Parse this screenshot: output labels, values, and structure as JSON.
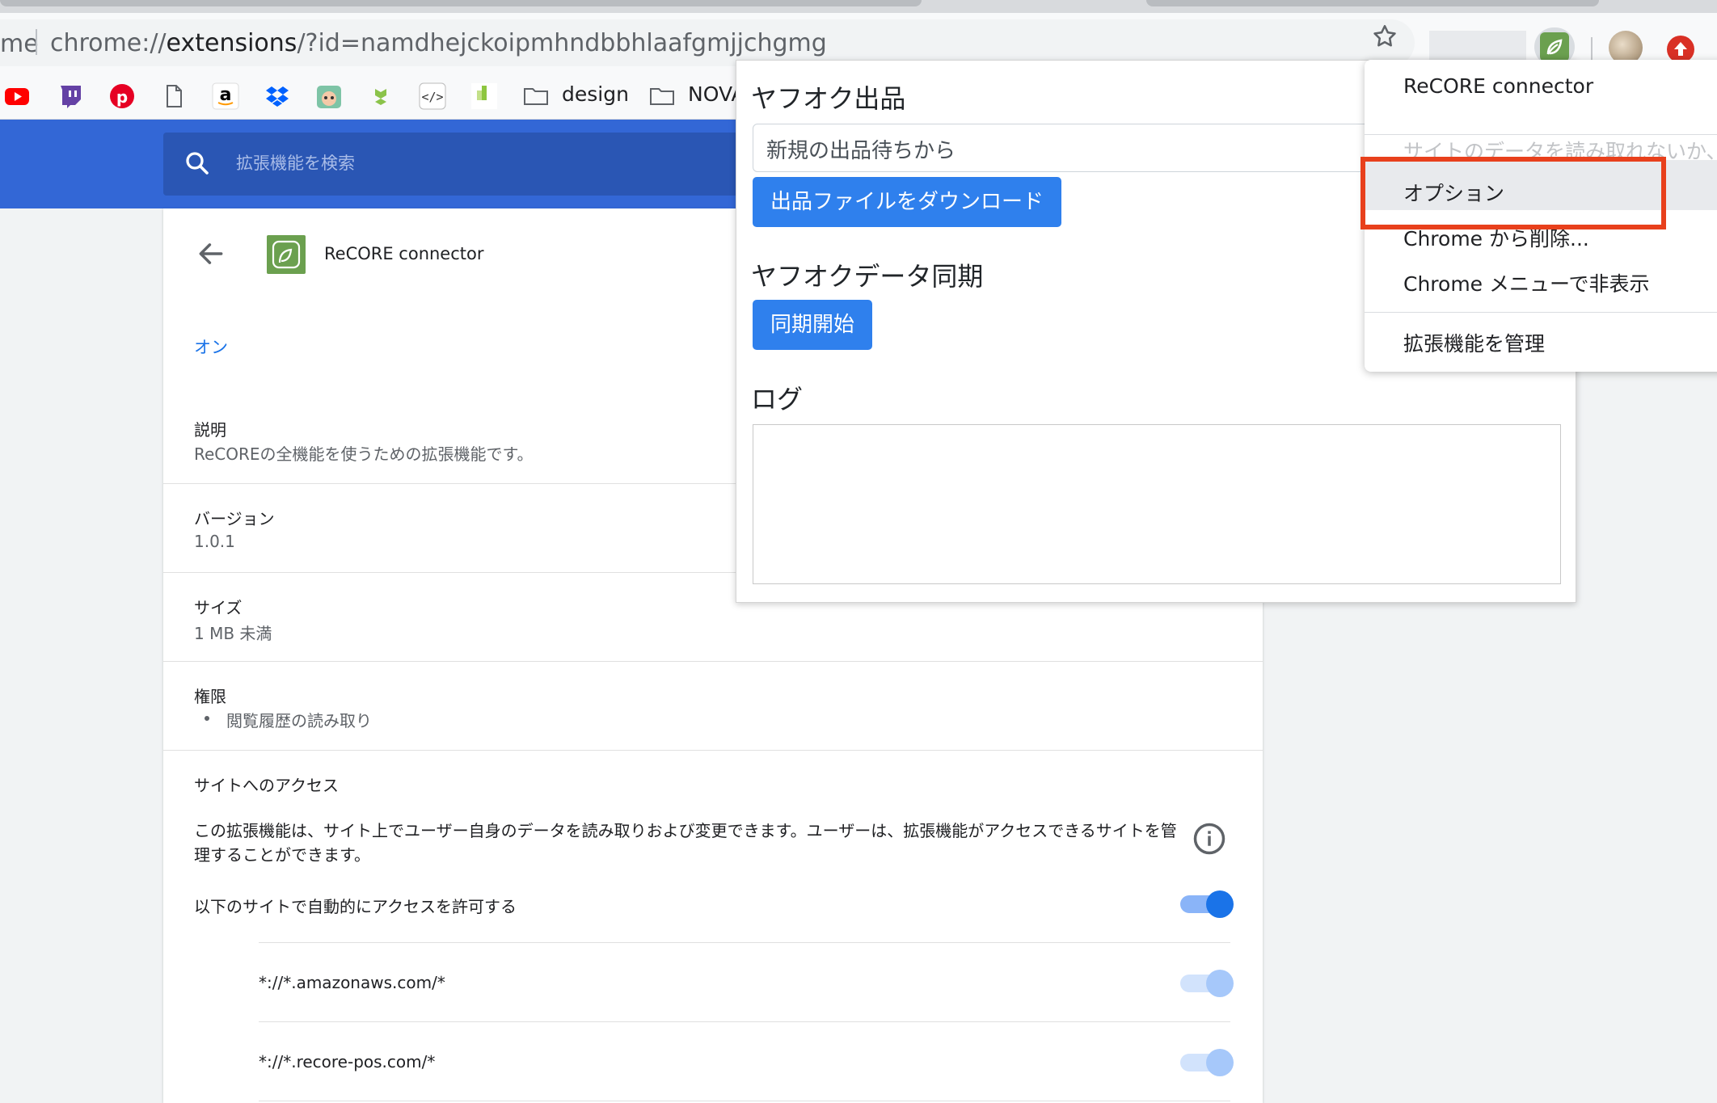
{
  "browser": {
    "url_prefix": "me",
    "url_scheme": "chrome://",
    "url_host": "extensions",
    "url_path": "/?id=namdhejckoipmhndbbhlaafgmjjchgmg",
    "bookmarks": [
      {
        "icon": "youtube-icon",
        "label": ""
      },
      {
        "icon": "twitch-icon",
        "label": ""
      },
      {
        "icon": "pinterest-icon",
        "label": ""
      },
      {
        "icon": "page-icon",
        "label": ""
      },
      {
        "icon": "amazon-icon",
        "label": ""
      },
      {
        "icon": "dropbox-icon",
        "label": ""
      },
      {
        "icon": "cat-icon",
        "label": ""
      },
      {
        "icon": "cubes-icon",
        "label": ""
      },
      {
        "icon": "code-icon",
        "label": ""
      },
      {
        "icon": "smbc-icon",
        "label": ""
      },
      {
        "icon": "folder-icon",
        "label": "design"
      },
      {
        "icon": "folder-icon",
        "label": "NOVA"
      }
    ]
  },
  "extensions_page": {
    "search_placeholder": "拡張機能を検索",
    "extension_name": "ReCORE connector",
    "status": "オン",
    "description_title": "説明",
    "description": "ReCOREの全機能を使うための拡張機能です。",
    "version_title": "バージョン",
    "version": "1.0.1",
    "size_title": "サイズ",
    "size": "1 MB 未満",
    "permissions_title": "権限",
    "permission_item": "閲覧履歴の読み取り",
    "site_access_title": "サイトへのアクセス",
    "site_access_desc_line1": "この拡張機能は、サイト上でユーザー自身のデータを読み取りおよび変更できます。ユーザーは、拡張機能がアクセスできるサイトを管",
    "site_access_desc_line2": "理することができます。",
    "auto_allow_label": "以下のサイトで自動的にアクセスを許可する",
    "sites": [
      "*://*.amazonaws.com/*",
      "*://*.recore-pos.com/*"
    ]
  },
  "popup": {
    "section1_title": "ヤフオク出品",
    "select_value": "新規の出品待ちから",
    "download_button": "出品ファイルをダウンロード",
    "section2_title": "ヤフオクデータ同期",
    "sync_button": "同期開始",
    "section3_title": "ログ"
  },
  "context_menu": {
    "title": "ReCORE connector",
    "site_data": "サイトのデータを読み取れないか、変",
    "options": "オプション",
    "remove": "Chrome から削除...",
    "hide": "Chrome メニューで非表示",
    "manage": "拡張機能を管理"
  },
  "colors": {
    "header_blue": "#3367d6",
    "button_blue": "#2f80ed",
    "link_blue": "#1a73e8",
    "highlight_red": "#e8401c",
    "extension_green": "#6ba04f"
  }
}
